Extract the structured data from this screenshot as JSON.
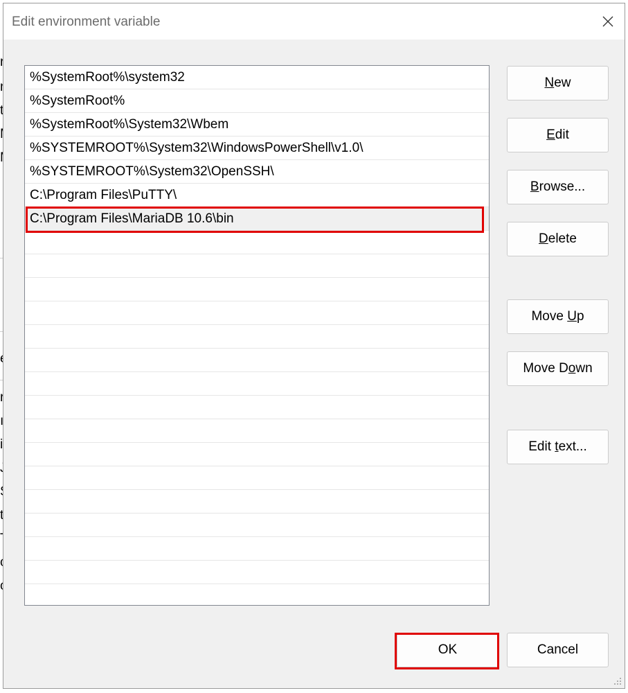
{
  "window": {
    "title": "Edit environment variable",
    "close_glyph": "✕"
  },
  "path_list": {
    "items": [
      "%SystemRoot%\\system32",
      "%SystemRoot%",
      "%SystemRoot%\\System32\\Wbem",
      "%SYSTEMROOT%\\System32\\WindowsPowerShell\\v1.0\\",
      "%SYSTEMROOT%\\System32\\OpenSSH\\",
      "C:\\Program Files\\PuTTY\\",
      "C:\\Program Files\\MariaDB 10.6\\bin"
    ],
    "selected_index": 6,
    "total_visible_rows": 23
  },
  "buttons": {
    "new": {
      "pre": "",
      "key": "N",
      "post": "ew"
    },
    "edit": {
      "pre": "",
      "key": "E",
      "post": "dit"
    },
    "browse": {
      "pre": "",
      "key": "B",
      "post": "rowse..."
    },
    "delete": {
      "pre": "",
      "key": "D",
      "post": "elete"
    },
    "move_up": {
      "pre": "Move ",
      "key": "U",
      "post": "p"
    },
    "move_down": {
      "pre": "Move D",
      "key": "o",
      "post": "wn"
    },
    "edit_text": {
      "pre": "Edit ",
      "key": "t",
      "post": "ext..."
    },
    "ok": "OK",
    "cancel": "Cancel"
  },
  "colors": {
    "highlight": "#e00000",
    "dialog_bg": "#f0f0f0"
  }
}
